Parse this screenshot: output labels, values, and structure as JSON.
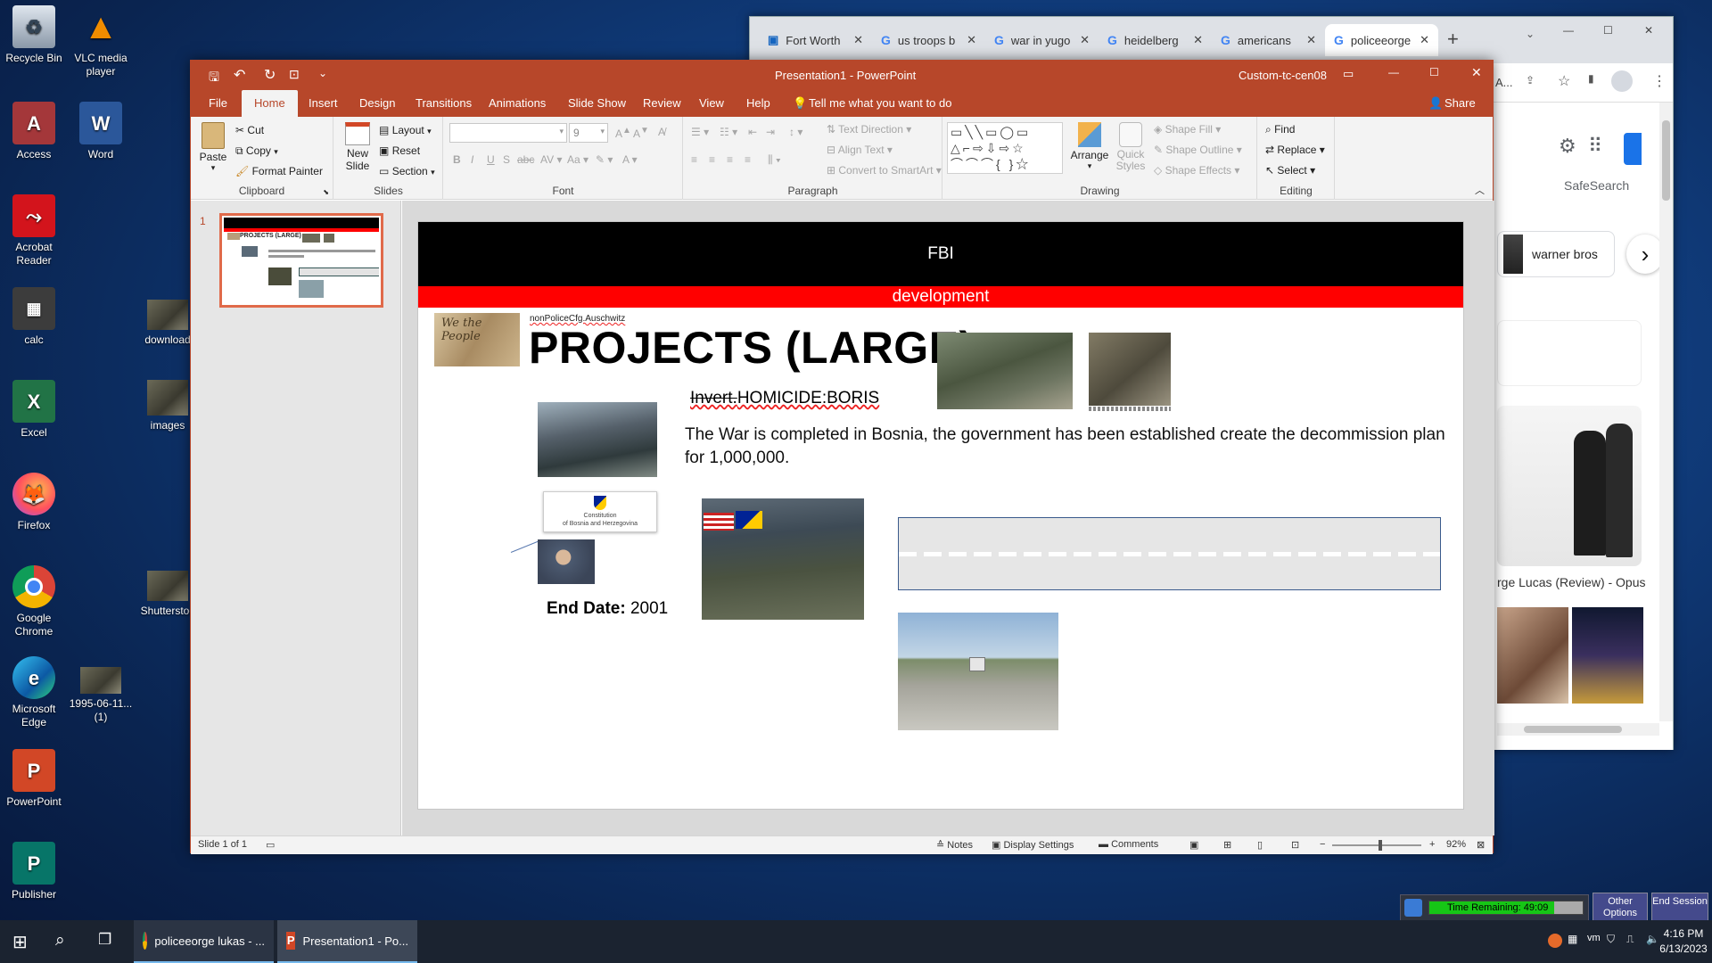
{
  "desktop": {
    "icons": [
      {
        "label": "Recycle Bin",
        "icon": "recycle-bin-icon"
      },
      {
        "label": "VLC media player",
        "icon": "vlc-icon"
      },
      {
        "label": "Access",
        "icon": "access-icon"
      },
      {
        "label": "Word",
        "icon": "word-icon"
      },
      {
        "label": "Acrobat Reader",
        "icon": "acrobat-icon"
      },
      {
        "label": "calc",
        "icon": "calculator-icon"
      },
      {
        "label": "download",
        "icon": "image-file-icon"
      },
      {
        "label": "Excel",
        "icon": "excel-icon"
      },
      {
        "label": "images",
        "icon": "image-file-icon"
      },
      {
        "label": "Firefox",
        "icon": "firefox-icon"
      },
      {
        "label": "Google Chrome",
        "icon": "chrome-icon"
      },
      {
        "label": "Shutterstoc",
        "icon": "image-file-icon"
      },
      {
        "label": "Microsoft Edge",
        "icon": "edge-icon"
      },
      {
        "label": "1995-06-11... (1)",
        "icon": "image-file-icon"
      },
      {
        "label": "PowerPoint",
        "icon": "powerpoint-icon"
      },
      {
        "label": "Publisher",
        "icon": "publisher-icon"
      }
    ]
  },
  "chrome": {
    "tabs": [
      "Fort Worth",
      "us troops b",
      "war in yugo",
      "heidelberg",
      "americans",
      "policeeorge"
    ],
    "addressbar_fragment": "A...",
    "safesearch": "SafeSearch",
    "chip": "warner bros",
    "result_caption": "rge Lucas (Review) - Opus"
  },
  "ppt": {
    "title": "Presentation1 - PowerPoint",
    "account": "Custom-tc-cen08",
    "menus": [
      "File",
      "Home",
      "Insert",
      "Design",
      "Transitions",
      "Animations",
      "Slide Show",
      "Review",
      "View",
      "Help"
    ],
    "tell_me": "Tell me what you want to do",
    "share": "Share",
    "ribbon": {
      "clipboard": {
        "label": "Clipboard",
        "paste": "Paste",
        "cut": "Cut",
        "copy": "Copy",
        "format_painter": "Format Painter"
      },
      "slides": {
        "label": "Slides",
        "new_slide": "New Slide",
        "layout": "Layout",
        "reset": "Reset",
        "section": "Section"
      },
      "font": {
        "label": "Font",
        "size": "9"
      },
      "paragraph": {
        "label": "Paragraph",
        "text_direction": "Text Direction",
        "align_text": "Align Text",
        "smartart": "Convert to SmartArt"
      },
      "drawing": {
        "label": "Drawing",
        "arrange": "Arrange",
        "quick_styles": "Quick Styles",
        "shape_fill": "Shape Fill",
        "shape_outline": "Shape Outline",
        "shape_effects": "Shape Effects"
      },
      "editing": {
        "label": "Editing",
        "find": "Find",
        "replace": "Replace",
        "select": "Select"
      }
    },
    "thumbnail_number": "1",
    "slide": {
      "header": "FBI",
      "subheader": "development",
      "small_caption": "nonPoliceCfg.Auschwitz",
      "heading": "PROJECTS (LARGE)",
      "invert_strike": "Invert.",
      "invert_rest": "HOMICIDE:BORIS",
      "body": "The War is completed in Bosnia, the government has been established create the decommission plan for 1,000,000.",
      "constitution_line1": "Constitution",
      "constitution_line2": "of Bosnia and Herzegovina",
      "end_label": "End Date:",
      "end_value": "2001"
    },
    "status": {
      "slide_info": "Slide 1 of 1",
      "notes": "Notes",
      "display_settings": "Display Settings",
      "comments": "Comments",
      "zoom": "92%"
    }
  },
  "session": {
    "time_remaining": "Time Remaining: 49:09",
    "other_options": "Other Options",
    "end_session": "End Session"
  },
  "taskbar": {
    "apps": [
      "policeeorge lukas - ...",
      "Presentation1 - Po..."
    ],
    "time": "4:16 PM",
    "date": "6/13/2023"
  }
}
